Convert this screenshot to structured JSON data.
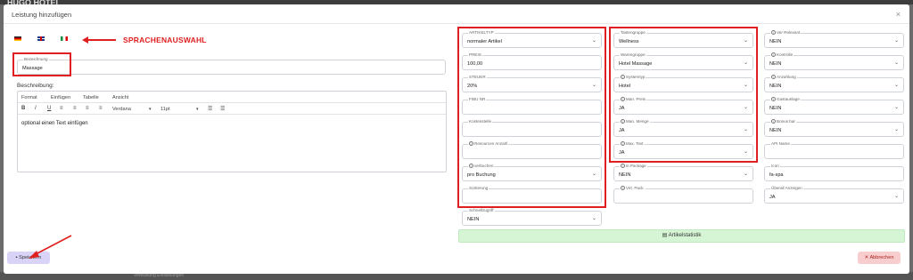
{
  "background": {
    "logo": "HUGO HOTEL",
    "bottom_text": "Verwaltung Einstellungen"
  },
  "modal": {
    "title": "Leistung hinzufügen",
    "close_icon": "×"
  },
  "languages": [
    {
      "name": "flag-de-icon"
    },
    {
      "name": "flag-gb-icon"
    },
    {
      "name": "flag-it-icon"
    }
  ],
  "annotations": {
    "language_selection": "SPRACHENAUSWAHL"
  },
  "bezeichnung": {
    "label": "Bezeichnung",
    "value": "Massage"
  },
  "beschreibung": {
    "label": "Beschreibung:",
    "menu": [
      "Format",
      "Einfügen",
      "Tabelle",
      "Ansicht"
    ],
    "font": "Verdana",
    "size": "11pt",
    "content": "optional einen Text einfügen"
  },
  "col1": {
    "artikeltyp": {
      "label": "ARTIKELTYP",
      "value": "normaler Artikel"
    },
    "preis": {
      "label": "PREIS",
      "value": "100,00"
    },
    "steuer": {
      "label": "STEUER",
      "value": "20%"
    },
    "fibu": {
      "label": "FIBU NR",
      "value": ""
    },
    "kostenstelle": {
      "label": "Kostenstelle",
      "value": ""
    },
    "ressourcen": {
      "label": "Resourcen Anzahl",
      "value": ""
    },
    "verbuchen": {
      "label": "verbuchen",
      "value": "pro Buchung"
    },
    "sortierung": {
      "label": "Sortierung",
      "value": ""
    },
    "schnellzugriff": {
      "label": "Schnellzugriff",
      "value": "NEIN"
    }
  },
  "col2": {
    "tastengruppe": {
      "label": "Tastengruppe",
      "value": "Wellness"
    },
    "warengruppe": {
      "label": "Warengruppe",
      "value": "Hotel Massage"
    },
    "systemtyp": {
      "label": "Systemtyp",
      "value": "Hotel"
    },
    "man_preis": {
      "label": "Man. Preis",
      "value": "JA"
    },
    "man_menge": {
      "label": "Man. Menge",
      "value": "JA"
    },
    "max_text": {
      "label": "Max. Text",
      "value": "JA"
    },
    "in_package": {
      "label": "in Package",
      "value": "NEIN"
    },
    "virt_pack": {
      "label": "Virt. Pack.",
      "value": ""
    }
  },
  "col3": {
    "ver_relevant": {
      "label": "Ver Relevant",
      "value": "NEIN"
    },
    "kontrolle": {
      "label": "Kontrolle",
      "value": "NEIN"
    },
    "anzahlung": {
      "label": "Anzahlung",
      "value": "NEIN"
    },
    "gastauslage": {
      "label": "Gastauslage",
      "value": "NEIN"
    },
    "bonus_bar": {
      "label": "Bonus bar",
      "value": "NEIN"
    },
    "api_name": {
      "label": "API Name",
      "value": ""
    },
    "icon": {
      "label": "Icon",
      "value": "fa-spa"
    },
    "ueberall": {
      "label": "Überall Anzeigen",
      "value": "JA"
    }
  },
  "buttons": {
    "stats": "Artikelstatistik",
    "save": "Speichern",
    "cancel": "Abbrechen"
  },
  "colors": {
    "annotation_red": "#e02020",
    "stats_bg": "#d5f5d4",
    "save_bg": "#d9d4f7",
    "cancel_bg": "#f8cdcd"
  }
}
